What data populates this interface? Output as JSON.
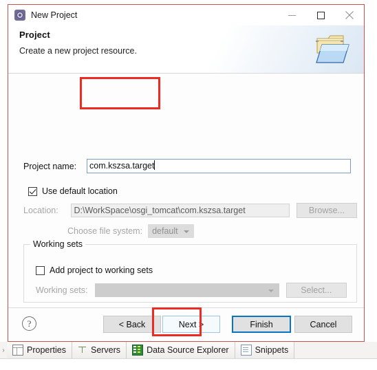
{
  "window": {
    "title": "New Project",
    "icon": "eclipse-wizard-icon",
    "controls": {
      "minimize": "minimize-icon",
      "maximize": "maximize-icon",
      "close": "close-icon"
    }
  },
  "header": {
    "title": "Project",
    "subtitle": "Create a new project resource.",
    "banner_icon": "folder-wizard-icon"
  },
  "form": {
    "project_name": {
      "label": "Project name:",
      "value": "com.kszsa.target",
      "placeholder": ""
    },
    "use_default_location": {
      "label": "Use default location",
      "checked": true
    },
    "location": {
      "label": "Location:",
      "value": "D:\\WorkSpace\\osgi_tomcat\\com.kszsa.target",
      "enabled": false
    },
    "browse_button": "Browse...",
    "file_system": {
      "label": "Choose file system:",
      "value": "default",
      "options": [
        "default"
      ],
      "enabled": false
    }
  },
  "working_sets": {
    "group_label": "Working sets",
    "add_checkbox": {
      "label": "Add project to working sets",
      "checked": false
    },
    "select_label": "Working sets:",
    "select_value": "",
    "select_button": "Select..."
  },
  "buttons": {
    "help": "?",
    "back": "< Back",
    "next": "Next >",
    "finish": "Finish",
    "cancel": "Cancel"
  },
  "annotations": {
    "name_box_color": "#ee2a22",
    "next_box_color": "#ee2a22"
  },
  "view_tabs": [
    {
      "label": "Properties",
      "icon": "properties-icon"
    },
    {
      "label": "Servers",
      "icon": "servers-icon"
    },
    {
      "label": "Data Source Explorer",
      "icon": "data-source-explorer-icon"
    },
    {
      "label": "Snippets",
      "icon": "snippets-icon"
    }
  ]
}
